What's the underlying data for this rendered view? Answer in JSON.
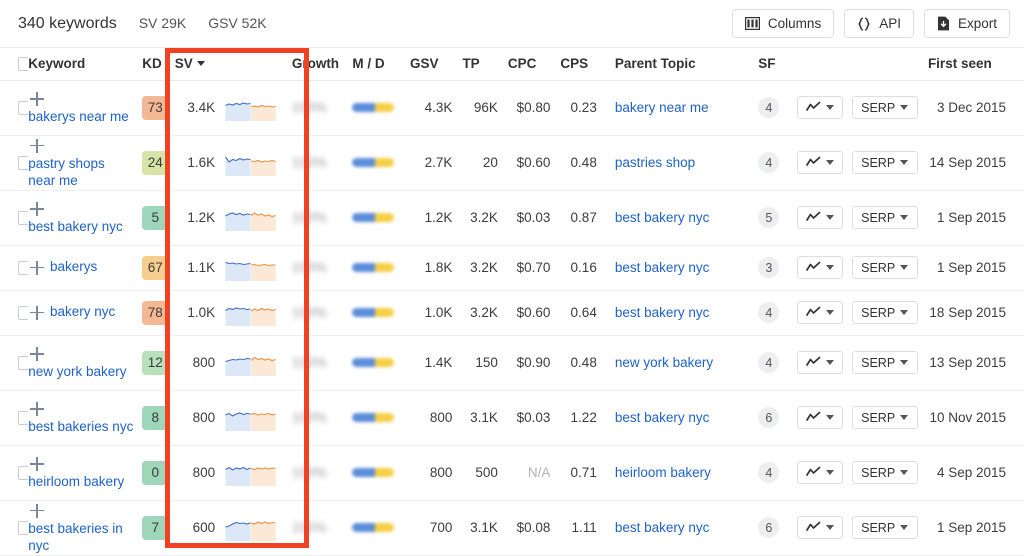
{
  "topbar": {
    "keyword_count": "340 keywords",
    "sv_total": "SV 29K",
    "gsv_total": "GSV 52K",
    "buttons": [
      {
        "label": "Columns",
        "icon": "columns-icon"
      },
      {
        "label": "API",
        "icon": "braces-icon"
      },
      {
        "label": "Export",
        "icon": "download-file-icon"
      }
    ]
  },
  "table": {
    "headers": {
      "keyword": "Keyword",
      "kd": "KD",
      "sv": "SV",
      "sv_sort": "descending",
      "growth": "Growth",
      "md": "M / D",
      "gsv": "GSV",
      "tp": "TP",
      "cpc": "CPC",
      "cps": "CPS",
      "parent_topic": "Parent Topic",
      "sf": "SF",
      "first_seen": "First seen"
    },
    "row_controls": {
      "chart_label": "",
      "serp_label": "SERP"
    },
    "growth_value": "100%",
    "rows": [
      {
        "keyword": "bakerys near me",
        "kd": "73",
        "kd_color": "#f5b895",
        "sv": "3.4K",
        "growth": "100%",
        "md_blue_pct": 55,
        "gsv": "4.3K",
        "tp": "96K",
        "cpc": "$0.80",
        "cps": "0.23",
        "parent_topic": "bakery near me",
        "sf": "4",
        "serp": "SERP",
        "first_seen": "3 Dec 2015",
        "spark_blue": [
          9,
          12,
          10,
          13,
          11,
          14,
          12,
          13
        ],
        "spark_orange": [
          7,
          8,
          6,
          9,
          7,
          8,
          6,
          7
        ]
      },
      {
        "keyword": "pastry shops near me",
        "kd": "24",
        "kd_color": "#d6e4a8",
        "sv": "1.6K",
        "growth": "100%",
        "md_blue_pct": 55,
        "gsv": "2.7K",
        "tp": "20",
        "cpc": "$0.60",
        "cps": "0.48",
        "parent_topic": "pastries shop",
        "sf": "4",
        "serp": "SERP",
        "first_seen": "14 Sep 2015",
        "spark_blue": [
          16,
          6,
          11,
          9,
          13,
          10,
          12,
          11
        ],
        "spark_orange": [
          8,
          7,
          9,
          6,
          8,
          7,
          9,
          7
        ]
      },
      {
        "keyword": "best bakery nyc",
        "kd": "5",
        "kd_color": "#9ed6ba",
        "sv": "1.2K",
        "growth": "100%",
        "md_blue_pct": 55,
        "gsv": "1.2K",
        "tp": "3.2K",
        "cpc": "$0.03",
        "cps": "0.87",
        "parent_topic": "best bakery nyc",
        "sf": "5",
        "serp": "SERP",
        "first_seen": "1 Sep 2015",
        "spark_blue": [
          8,
          12,
          14,
          11,
          13,
          10,
          12,
          11
        ],
        "spark_orange": [
          9,
          14,
          10,
          12,
          8,
          10,
          7,
          9
        ]
      },
      {
        "keyword": "bakerys",
        "kd": "67",
        "kd_color": "#f8ce8f",
        "sv": "1.1K",
        "growth": "100%",
        "md_blue_pct": 55,
        "gsv": "1.8K",
        "tp": "3.2K",
        "cpc": "$0.70",
        "cps": "0.16",
        "parent_topic": "best bakery nyc",
        "sf": "3",
        "serp": "SERP",
        "first_seen": "1 Sep 2015",
        "spark_blue": [
          15,
          13,
          14,
          12,
          13,
          11,
          12,
          13
        ],
        "spark_orange": [
          10,
          11,
          9,
          10,
          11,
          9,
          10,
          10
        ]
      },
      {
        "keyword": "bakery nyc",
        "kd": "78",
        "kd_color": "#f5b895",
        "sv": "1.0K",
        "growth": "100%",
        "md_blue_pct": 55,
        "gsv": "1.0K",
        "tp": "3.2K",
        "cpc": "$0.60",
        "cps": "0.64",
        "parent_topic": "best bakery nyc",
        "sf": "4",
        "serp": "SERP",
        "first_seen": "18 Sep 2015",
        "spark_blue": [
          9,
          13,
          11,
          14,
          12,
          13,
          11,
          12
        ],
        "spark_orange": [
          8,
          12,
          9,
          13,
          10,
          12,
          9,
          11
        ]
      },
      {
        "keyword": "new york bakery",
        "kd": "12",
        "kd_color": "#b9e0bd",
        "sv": "800",
        "growth": "100%",
        "md_blue_pct": 55,
        "gsv": "1.4K",
        "tp": "150",
        "cpc": "$0.90",
        "cps": "0.48",
        "parent_topic": "new york bakery",
        "sf": "4",
        "serp": "SERP",
        "first_seen": "13 Sep 2015",
        "spark_blue": [
          7,
          9,
          11,
          10,
          12,
          11,
          13,
          12
        ],
        "spark_orange": [
          9,
          15,
          11,
          13,
          10,
          12,
          9,
          11
        ]
      },
      {
        "keyword": "best bakeries nyc",
        "kd": "8",
        "kd_color": "#9ed6ba",
        "sv": "800",
        "growth": "100%",
        "md_blue_pct": 55,
        "gsv": "800",
        "tp": "3.1K",
        "cpc": "$0.03",
        "cps": "1.22",
        "parent_topic": "best bakery nyc",
        "sf": "6",
        "serp": "SERP",
        "first_seen": "10 Nov 2015",
        "spark_blue": [
          10,
          13,
          8,
          12,
          14,
          11,
          13,
          12
        ],
        "spark_orange": [
          11,
          13,
          10,
          12,
          11,
          13,
          10,
          12
        ]
      },
      {
        "keyword": "heirloom bakery",
        "kd": "0",
        "kd_color": "#9ed6ba",
        "sv": "800",
        "growth": "100%",
        "md_blue_pct": 55,
        "gsv": "800",
        "tp": "500",
        "cpc": "N/A",
        "cps": "0.71",
        "parent_topic": "heirloom bakery",
        "sf": "4",
        "serp": "SERP",
        "first_seen": "4 Sep 2015",
        "spark_blue": [
          11,
          15,
          10,
          14,
          12,
          15,
          11,
          14
        ],
        "spark_orange": [
          13,
          11,
          14,
          12,
          14,
          12,
          14,
          13
        ]
      },
      {
        "keyword": "best bakeries in nyc",
        "kd": "7",
        "kd_color": "#9ed6ba",
        "sv": "600",
        "growth": "100%",
        "md_blue_pct": 55,
        "gsv": "700",
        "tp": "3.1K",
        "cpc": "$0.08",
        "cps": "1.11",
        "parent_topic": "best bakery nyc",
        "sf": "6",
        "serp": "SERP",
        "first_seen": "1 Sep 2015",
        "spark_blue": [
          6,
          8,
          12,
          15,
          13,
          14,
          12,
          14
        ],
        "spark_orange": [
          14,
          12,
          16,
          13,
          16,
          13,
          15,
          14
        ]
      }
    ]
  },
  "annotation": {
    "highlight_color": "#f04123",
    "highlight_target": "kd-sv-columns"
  }
}
